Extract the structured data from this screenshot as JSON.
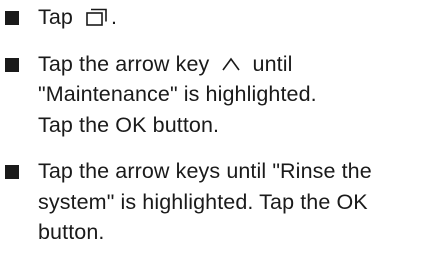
{
  "steps": [
    {
      "prefix": "Tap",
      "icon": "window-stack-icon",
      "suffix": "."
    },
    {
      "before_icon": "Tap the arrow key",
      "icon": "arrow-up-caret-icon",
      "after_icon": "until",
      "line2": "\"Maintenance\" is highlighted.",
      "line3": "Tap the OK button."
    },
    {
      "line1": "Tap the arrow keys until \"Rinse the",
      "line2": "system\" is highlighted. Tap the OK",
      "line3": "button."
    }
  ]
}
